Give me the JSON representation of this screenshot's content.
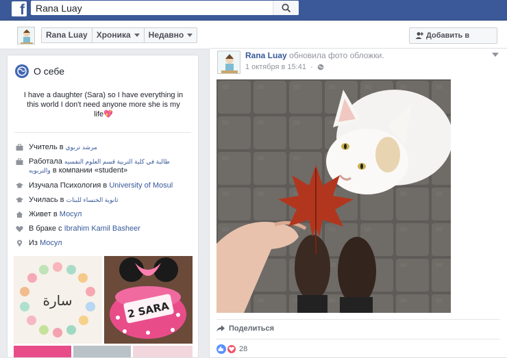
{
  "header": {
    "search_value": "Rana Luay"
  },
  "profile_nav": {
    "name": "Rana Luay",
    "timeline": "Хроника",
    "recent": "Недавно",
    "add_friend": "Добавить в друзья"
  },
  "intro": {
    "title": "О себе",
    "bio": "I have a daughter (Sara) so I have everything in this world I don't need anyone more she is my life",
    "bio_emoji": "💖",
    "items": [
      {
        "icon": "briefcase-icon",
        "prefix": "Учитель в ",
        "link": "مرشد تربوي",
        "suffix": ""
      },
      {
        "icon": "briefcase-icon",
        "prefix": "Работала ",
        "link": "طالبة في كلية التربية قسم العلوم النفسيه والتربويه",
        "suffix": " в компании «student»"
      },
      {
        "icon": "graduation-cap-icon",
        "prefix": "Изучала Психология в ",
        "link": "University of Mosul",
        "suffix": ""
      },
      {
        "icon": "graduation-cap-icon",
        "prefix": "Училась в ",
        "link": "ثانوية الخنساء للبنات",
        "suffix": ""
      },
      {
        "icon": "home-icon",
        "prefix": "Живет в ",
        "link": "Мосул",
        "suffix": ""
      },
      {
        "icon": "heart-icon",
        "prefix": "В браке с ",
        "link": "Ibrahim Kamil Basheer",
        "suffix": ""
      },
      {
        "icon": "location-pin-icon",
        "prefix": "Из ",
        "link": "Мосул",
        "suffix": ""
      }
    ],
    "photo_texts": [
      "سارة",
      "2 SARA"
    ]
  },
  "post": {
    "author": "Rana Luay",
    "action": "обновила фото обложки.",
    "date": "1 октября в 15:41",
    "share": "Поделиться",
    "reaction_count": "28"
  },
  "colors": {
    "brand": "#3b5998",
    "link": "#365899",
    "background": "#e9ebee"
  }
}
